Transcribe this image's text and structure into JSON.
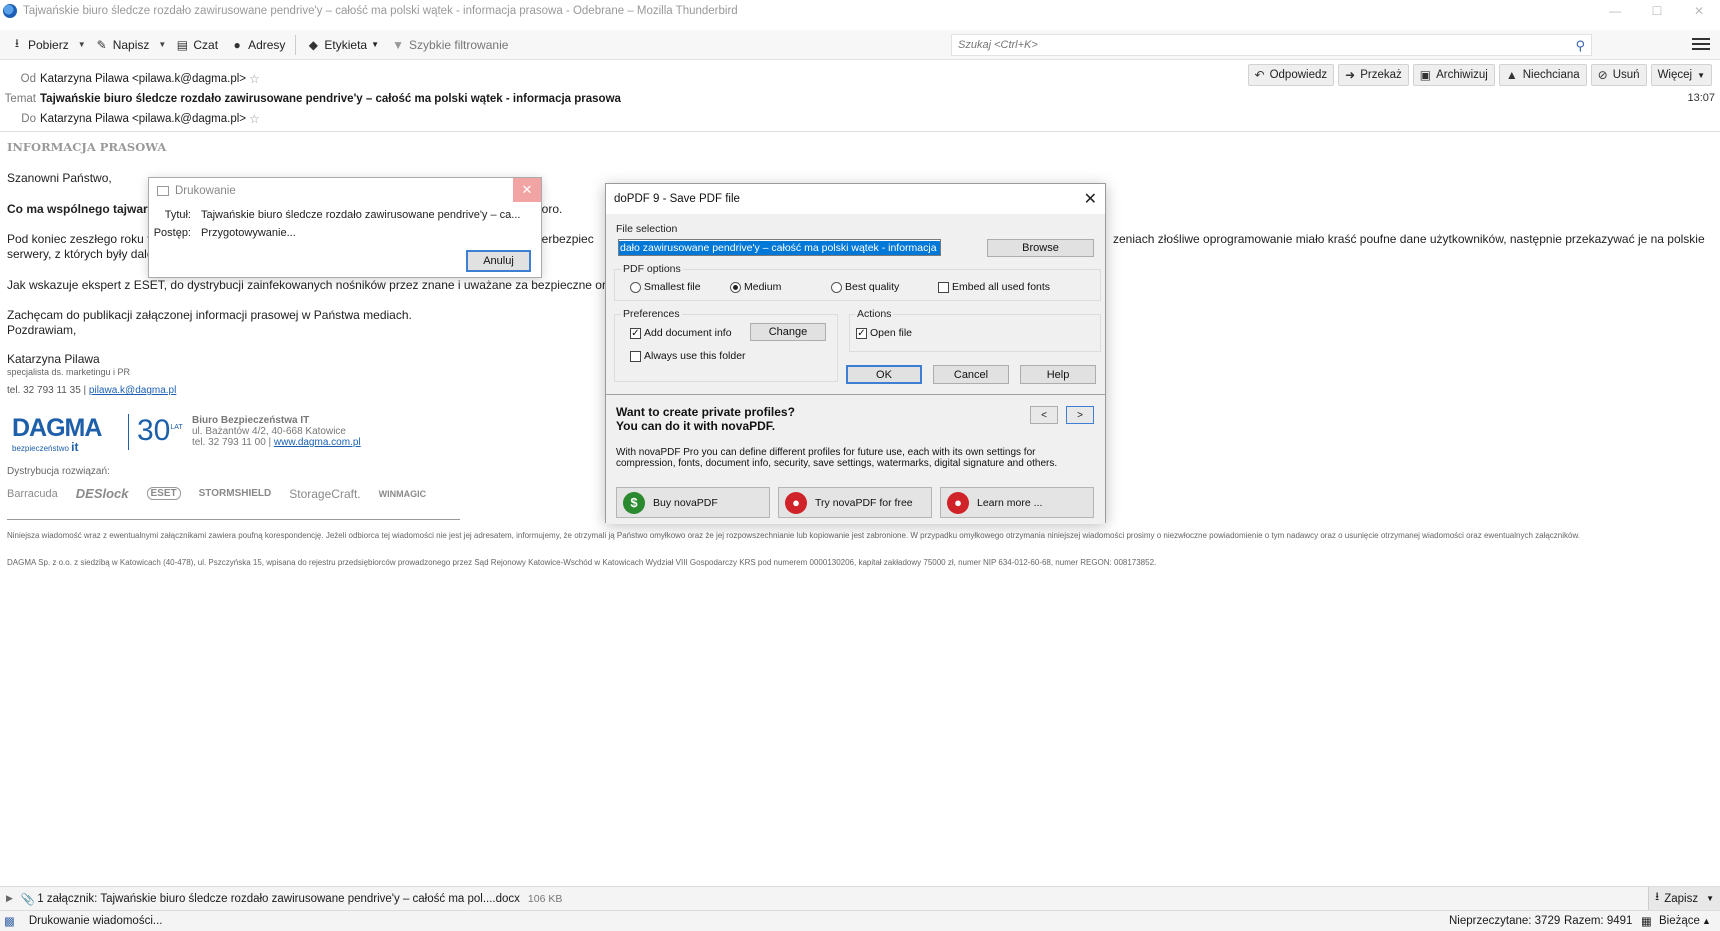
{
  "window": {
    "title": "Tajwańskie biuro śledcze rozdało zawirusowane pendrive'y – całość ma polski wątek - informacja prasowa - Odebrane – Mozilla Thunderbird"
  },
  "toolbar": {
    "get": "Pobierz",
    "write": "Napisz",
    "chat": "Czat",
    "address": "Adresy",
    "tag": "Etykieta",
    "quickfilter": "Szybkie filtrowanie",
    "search_placeholder": "Szukaj <Ctrl+K>"
  },
  "header": {
    "from_label": "Od",
    "from_value": "Katarzyna Pilawa <pilawa.k@dagma.pl>",
    "subject_label": "Temat",
    "subject_value": "Tajwańskie biuro śledcze rozdało zawirusowane pendrive'y – całość ma polski wątek - informacja prasowa",
    "to_label": "Do",
    "to_value": "Katarzyna Pilawa <pilawa.k@dagma.pl>",
    "time": "13:07",
    "actions": [
      "Odpowiedz",
      "Przekaż",
      "Archiwizuj",
      "Niechciana",
      "Usuń",
      "Więcej"
    ]
  },
  "message": {
    "heading": "INFORMACJA PRASOWA",
    "greeting": "Szanowni Państwo,",
    "bold_line_start": "Co ma wspólnego tajwar",
    "bold_line_end": "sporo.",
    "para1_a": "Pod koniec zeszłego roku ta",
    "para1_mid": "yberbezpiec",
    "para1_end": "zeniach złośliwe oprogramowanie miało kraść poufne dane użytkowników, następnie przekazywać je na polskie",
    "para1_b": "serwery, z których były dale",
    "para2": "Jak wskazuje ekspert z ESET, do dystrybucji zainfekowanych nośników przez znane i uważane za bezpieczne organiz",
    "para3": "Zachęcam do publikacji załączonej informacji prasowej w Państwa mediach.",
    "closing": "Pozdrawiam,",
    "sig_name": "Katarzyna Pilawa",
    "sig_title": "specjalista ds. marketingu i PR",
    "sig_phone": "tel. 32 793 11 35 |",
    "sig_email": "pilawa.k@dagma.pl",
    "company_name": "Biuro Bezpieczeństwa IT",
    "company_addr": "ul. Bażantów 4/2, 40-668 Katowice",
    "company_phone": "tel. 32 793 11 00 |",
    "company_web": "www.dagma.com.pl",
    "logo_main": "DAGMA",
    "logo_sub": "bezpieczeństwo",
    "logo_it": "it",
    "logo_30": "30",
    "logo_lat": "LAT",
    "distribution": "Dystrybucja rozwiązań:",
    "brands": [
      "Barracuda",
      "DESlock",
      "ESET",
      "STORMSHIELD",
      "StorageCraft.",
      "WINMAGIC"
    ],
    "disclaimer1": "Niniejsza wiadomość wraz z ewentualnymi załącznikami zawiera poufną korespondencję. Jeżeli odbiorca tej wiadomości nie jest jej adresatem, informujemy, że otrzymali ją Państwo omyłkowo oraz że jej rozpowszechnianie lub kopiowanie jest zabronione. W przypadku omyłkowego otrzymania niniejszej wiadomości prosimy o niezwłoczne powiadomienie o tym nadawcy oraz o usunięcie otrzymanej wiadomości oraz ewentualnych załączników.",
    "disclaimer2": "DAGMA Sp. z o.o. z siedzibą w Katowicach (40-478), ul. Pszczyńska 15, wpisana do rejestru przedsiębiorców prowadzonego przez Sąd Rejonowy Katowice-Wschód w Katowicach Wydział VIII Gospodarczy KRS pod numerem 0000130206, kapitał zakładowy 75000 zł, numer NIP 634-012-60-68, numer REGON: 008173852."
  },
  "attachment": {
    "label": "1 załącznik: Tajwańskie biuro śledcze rozdało zawirusowane pendrive'y – całość ma pol....docx",
    "size": "106 KB",
    "save": "Zapisz"
  },
  "status": {
    "text": "Drukowanie wiadomości...",
    "unread": "Nieprzeczytane: 3729",
    "total": "Razem: 9491",
    "current": "Bieżące"
  },
  "print_dialog": {
    "title": "Drukowanie",
    "title_label": "Tytuł:",
    "title_value": "Tajwańskie biuro śledcze rozdało zawirusowane pendrive'y – ca...",
    "progress_label": "Postęp:",
    "progress_value": "Przygotowywanie...",
    "cancel": "Anuluj"
  },
  "pdf_dialog": {
    "title": "doPDF 9 - Save PDF file",
    "file_selection": "File selection",
    "filename": "dało zawirusowane pendrive'y – całość ma polski wątek - informacja prasowa.pdf",
    "browse": "Browse",
    "pdf_options": "PDF options",
    "opt_smallest": "Smallest file",
    "opt_medium": "Medium",
    "opt_best": "Best quality",
    "opt_embed": "Embed all used fonts",
    "preferences": "Preferences",
    "pref_add_info": "Add document info",
    "pref_change": "Change",
    "pref_always": "Always use this folder",
    "actions": "Actions",
    "act_open": "Open file",
    "ok": "OK",
    "cancel": "Cancel",
    "help": "Help",
    "promo_line1": "Want to create private profiles?",
    "promo_line2": "You can do it with novaPDF.",
    "promo_desc": "With novaPDF Pro you can define different profiles for future use, each with its own settings for compression, fonts, document info, security, save settings, watermarks, digital signature and others.",
    "prev": "<",
    "next": ">",
    "buy": "Buy novaPDF",
    "try": "Try novaPDF for free",
    "learn": "Learn more ..."
  }
}
